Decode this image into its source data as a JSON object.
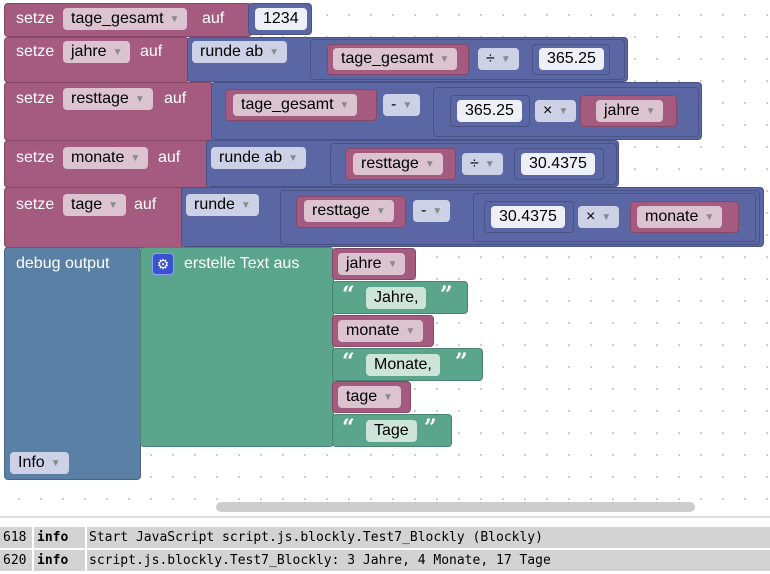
{
  "colors": {
    "variable": "#a55b80",
    "math": "#5b67a5",
    "text": "#5ba58c",
    "debug": "#5b80a5"
  },
  "kw": {
    "setze": "setze",
    "auf": "auf",
    "runde_ab": "runde ab",
    "runde": "runde",
    "debug": "debug output",
    "join": "erstelle Text aus",
    "level": "Info"
  },
  "ops": {
    "div": "÷",
    "minus": "-",
    "times": "×"
  },
  "vars": {
    "tage_gesamt": "tage_gesamt",
    "jahre": "jahre",
    "resttage": "resttage",
    "monate": "monate",
    "tage": "tage"
  },
  "nums": {
    "n1234": "1234",
    "year": "365.25",
    "month": "30.4375"
  },
  "texts": {
    "jahre": "Jahre, ",
    "monate": "Monate, ",
    "tage": "Tage"
  },
  "quotes": {
    "open": "“",
    "close": "”"
  },
  "icons": {
    "gear": "gear-icon",
    "dropdown": "chevron-down-icon"
  },
  "log": [
    {
      "id": "618",
      "level": "info",
      "message": "Start JavaScript script.js.blockly.Test7_Blockly (Blockly)"
    },
    {
      "id": "620",
      "level": "info",
      "message": "script.js.blockly.Test7_Blockly: 3 Jahre, 4 Monate, 17 Tage"
    }
  ]
}
